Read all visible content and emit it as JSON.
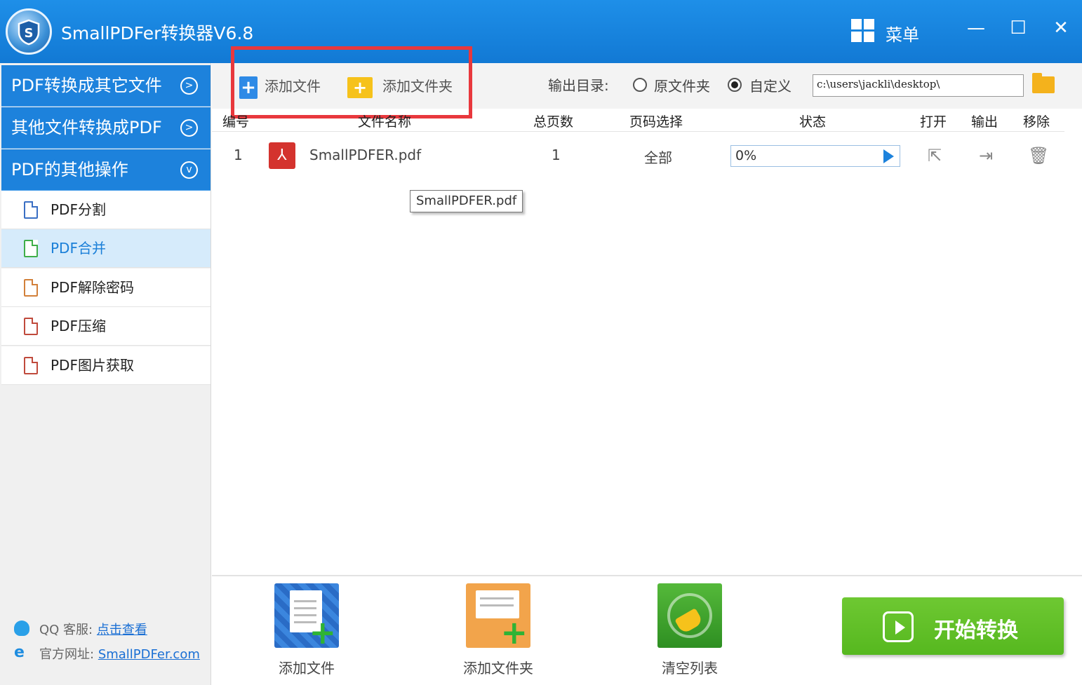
{
  "app": {
    "title": "SmallPDFer转换器V6.8",
    "menu_label": "菜单",
    "minimize": "—",
    "maximize": "☐",
    "close": "✕"
  },
  "sidebar": {
    "categories": [
      {
        "label": "PDF转换成其它文件",
        "icon": "chevron-right-icon"
      },
      {
        "label": "其他文件转换成PDF",
        "icon": "chevron-right-icon"
      },
      {
        "label": "PDF的其他操作",
        "icon": "chevron-down-icon"
      }
    ],
    "items": [
      {
        "label": "PDF分割"
      },
      {
        "label": "PDF合并",
        "active": true
      },
      {
        "label": "PDF解除密码"
      },
      {
        "label": "PDF压缩"
      },
      {
        "label": "PDF图片获取"
      }
    ],
    "footer": {
      "qq_label": "QQ 客服:",
      "qq_link": "点击查看",
      "site_label": "官方网址:",
      "site_link": "SmallPDFer.com"
    }
  },
  "toolbar": {
    "add_file": "添加文件",
    "add_folder": "添加文件夹",
    "output_label": "输出目录:",
    "radio_original": "原文件夹",
    "radio_custom": "自定义",
    "output_path": "c:\\users\\jackli\\desktop\\"
  },
  "table": {
    "headers": [
      "编号",
      "文件名称",
      "总页数",
      "页码选择",
      "状态",
      "打开",
      "输出",
      "移除"
    ],
    "rows": [
      {
        "index": "1",
        "name": "SmallPDFER.pdf",
        "pages": "1",
        "page_select": "全部",
        "status": "0%",
        "progress": 0
      }
    ],
    "tooltip": "SmallPDFER.pdf"
  },
  "bottom": {
    "add_file": "添加文件",
    "add_folder": "添加文件夹",
    "clear_list": "清空列表",
    "start": "开始转换"
  },
  "colors": {
    "title_bar": "#1e8fe8",
    "sidebar_category": "#1d82dc",
    "active_item_bg": "#d6ebfb",
    "highlight_box": "#e8383d",
    "start_button": "#6ec832"
  }
}
